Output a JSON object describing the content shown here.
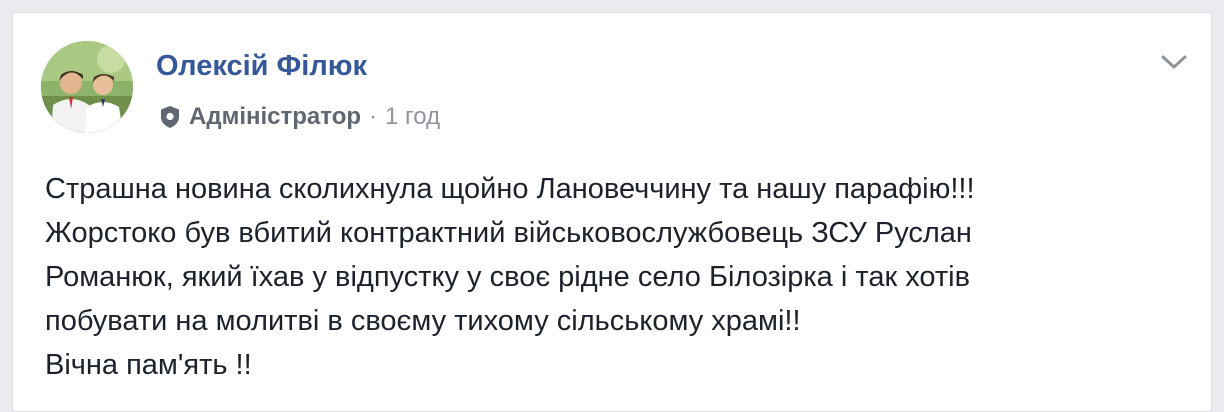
{
  "post": {
    "author": "Олексій Філюк",
    "role": "Адміністратор",
    "separator": "·",
    "time": "1 год",
    "lines": [
      "Страшна новина сколихнула щойно Лановеччину та нашу парафію!!!",
      "Жорстоко був вбитий контрактний військовослужбовець ЗСУ Руслан",
      "Романюк, який їхав у відпустку у своє рідне село Білозірка і так хотів",
      "побувати на молитві в своєму тихому сільському храмі!!",
      "Вічна пам'ять !!"
    ]
  },
  "colors": {
    "background": "#e9ebee",
    "card": "#ffffff",
    "author": "#365899",
    "meta": "#616770",
    "text": "#1d2129"
  },
  "icons": {
    "role": "shield-icon",
    "options": "chevron-down-icon"
  }
}
